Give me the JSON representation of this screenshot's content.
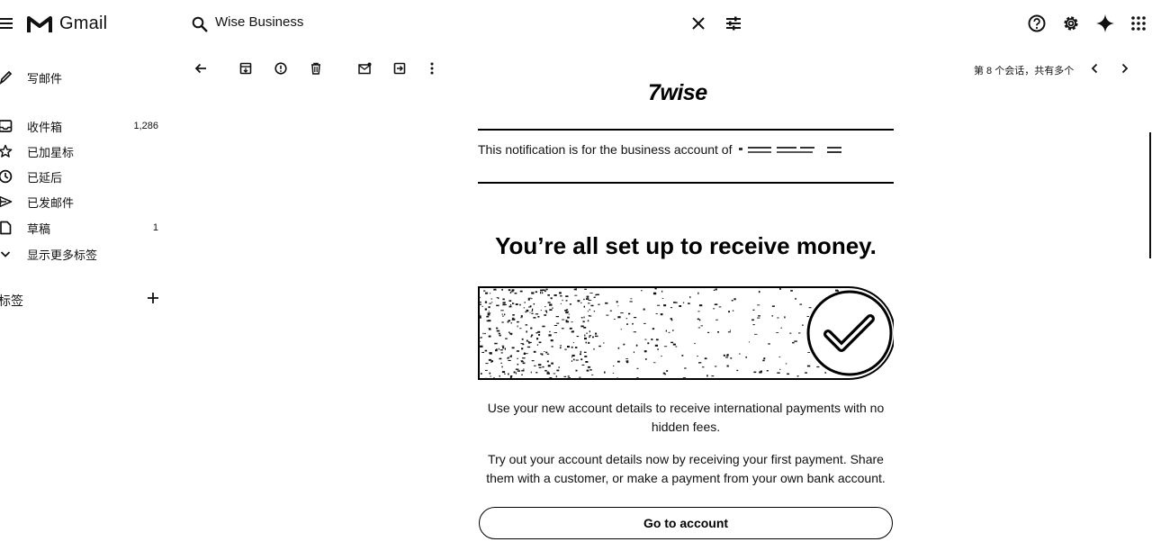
{
  "app": {
    "name": "Gmail"
  },
  "search": {
    "query": "Wise Business"
  },
  "compose": {
    "label": "写邮件"
  },
  "sidebar": {
    "items": [
      {
        "label": "收件箱",
        "count": "1,286",
        "icon": "inbox-icon"
      },
      {
        "label": "已加星标",
        "count": "",
        "icon": "star-icon"
      },
      {
        "label": "已延后",
        "count": "",
        "icon": "clock-icon"
      },
      {
        "label": "已发邮件",
        "count": "",
        "icon": "send-icon"
      },
      {
        "label": "草稿",
        "count": "1",
        "icon": "draft-icon"
      },
      {
        "label": "显示更多标签",
        "count": "",
        "icon": "chevron-down-icon"
      }
    ],
    "labels_heading": "标签"
  },
  "toolbar": {
    "pager_text": "第 8 个会话，共有多个"
  },
  "email": {
    "logo_text": "7wise",
    "notification": "This notification is for the business account of",
    "headline": "You’re all set up to receive money.",
    "paragraph1": "Use your new account details to receive international payments with no hidden fees.",
    "paragraph2": "Try out your account details now by receiving your first payment. Share them with a customer, or make a payment from your own bank account.",
    "cta": "Go to account"
  }
}
